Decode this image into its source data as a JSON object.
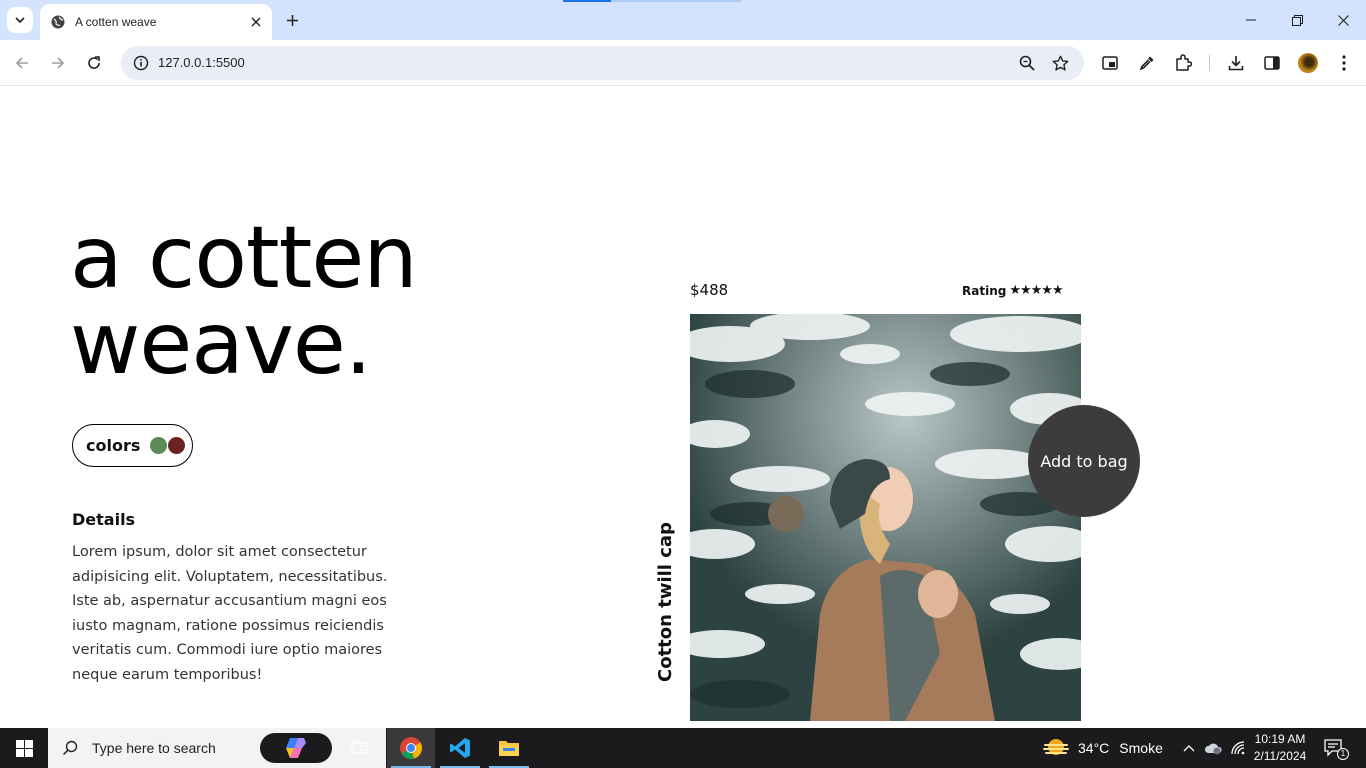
{
  "browser": {
    "tab_title": "A cotten weave",
    "url": "127.0.0.1:5500",
    "icons": [
      "tab-search-icon",
      "globe-icon",
      "close-icon",
      "plus-icon",
      "back-icon",
      "forward-icon",
      "reload-icon",
      "info-icon",
      "zoom-icon",
      "star-icon",
      "pip-icon",
      "eyedropper-icon",
      "puzzle-icon",
      "download-icon",
      "sidepanel-icon",
      "kebab-icon"
    ]
  },
  "page": {
    "heading": "a cotten weave.",
    "colors_label": "colors",
    "swatches": [
      "#5b8a58",
      "#6b2222"
    ],
    "details_title": "Details",
    "details_text": "Lorem ipsum, dolor sit amet consectetur adipisicing elit. Voluptatem, necessitatibus. Iste ab, aspernatur accusantium magni eos iusto magnam, ratione possimus reiciendis veritatis cum. Commodi iure optio maiores neque earum temporibus!",
    "price": "$488",
    "rating_label": "Rating",
    "rating_stars": 5,
    "stars_text": "★★★★★",
    "product_name": "Cotton twill cap",
    "add_to_bag": "Add to bag"
  },
  "taskbar": {
    "search_placeholder": "Type here to search",
    "temperature": "34°C",
    "weather": "Smoke",
    "time": "10:19 AM",
    "date": "2/11/2024",
    "notification_count": "1"
  }
}
